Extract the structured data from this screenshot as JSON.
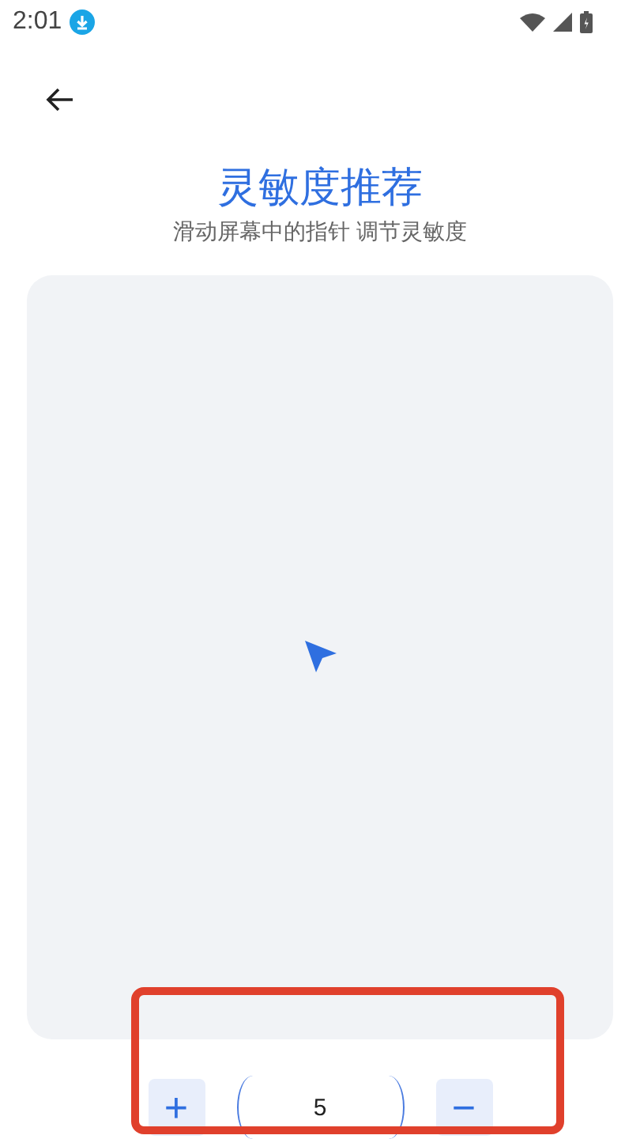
{
  "status_bar": {
    "time": "2:01"
  },
  "header": {
    "title": "灵敏度推荐",
    "subtitle": "滑动屏幕中的指针 调节灵敏度"
  },
  "controls": {
    "increase": "+",
    "value": "5",
    "decrease": "−"
  }
}
